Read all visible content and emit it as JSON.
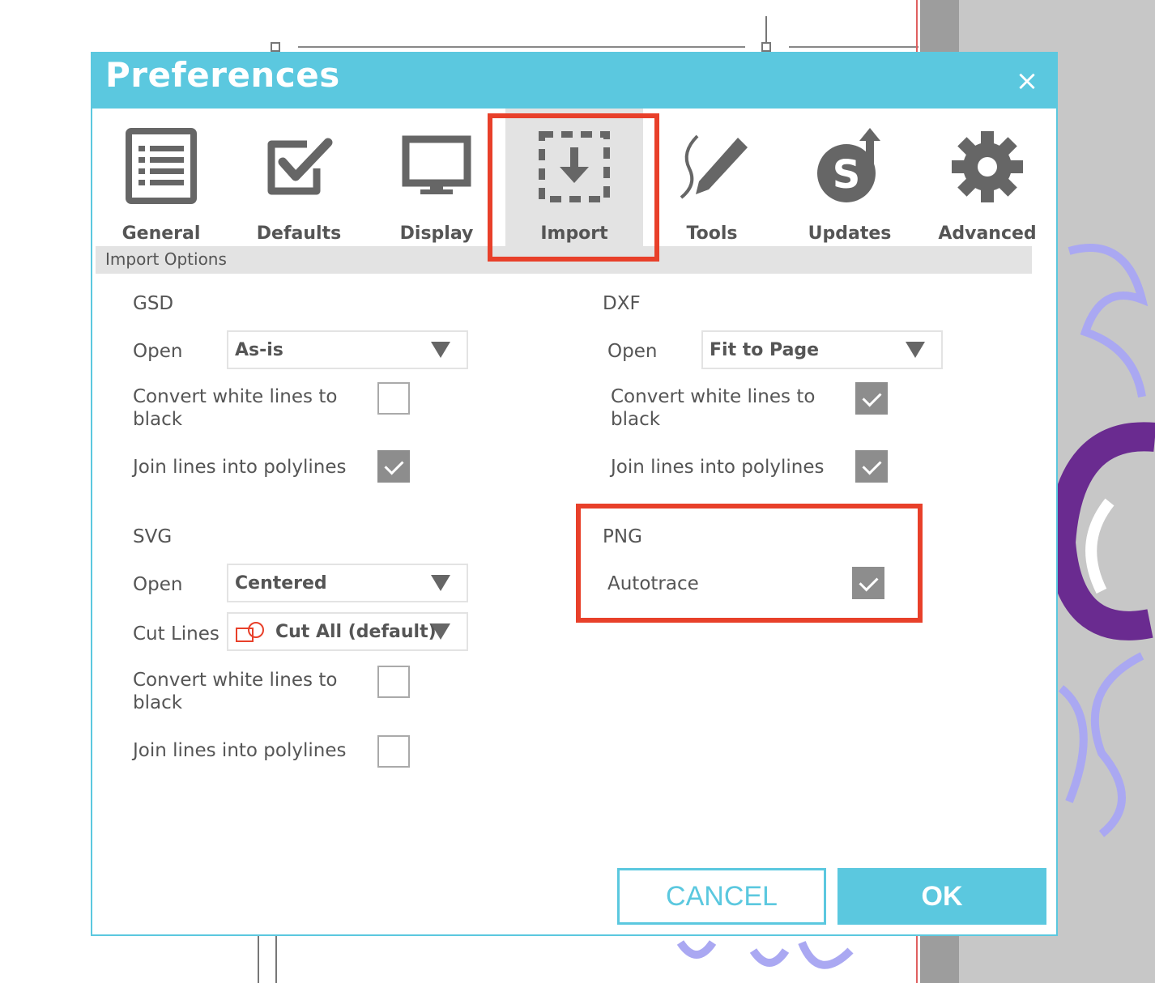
{
  "dialog": {
    "title": "Preferences",
    "close_glyph": "×"
  },
  "tabs": [
    {
      "label": "General",
      "icon": "list-icon"
    },
    {
      "label": "Defaults",
      "icon": "checkbox-icon"
    },
    {
      "label": "Display",
      "icon": "monitor-icon"
    },
    {
      "label": "Import",
      "icon": "import-icon",
      "active": true
    },
    {
      "label": "Tools",
      "icon": "pencil-icon"
    },
    {
      "label": "Updates",
      "icon": "updates-icon"
    },
    {
      "label": "Advanced",
      "icon": "gear-icon"
    }
  ],
  "section_header": "Import Options",
  "gsd": {
    "title": "GSD",
    "open_label": "Open",
    "open_value": "As-is",
    "convert_label": "Convert white lines to black",
    "convert_checked": false,
    "join_label": "Join lines into polylines",
    "join_checked": true
  },
  "svg": {
    "title": "SVG",
    "open_label": "Open",
    "open_value": "Centered",
    "cut_label": "Cut Lines",
    "cut_value": "Cut All (default)",
    "convert_label": "Convert white lines to black",
    "convert_checked": false,
    "join_label": "Join lines into polylines",
    "join_checked": false
  },
  "dxf": {
    "title": "DXF",
    "open_label": "Open",
    "open_value": "Fit to Page",
    "convert_label": "Convert white lines to black",
    "convert_checked": true,
    "join_label": "Join lines into polylines",
    "join_checked": true
  },
  "png": {
    "title": "PNG",
    "autotrace_label": "Autotrace",
    "autotrace_checked": true
  },
  "buttons": {
    "cancel": "CANCEL",
    "ok": "OK"
  },
  "colors": {
    "accent": "#5bc8df",
    "highlight": "#e8402a",
    "checked": "#8d8d8d"
  }
}
